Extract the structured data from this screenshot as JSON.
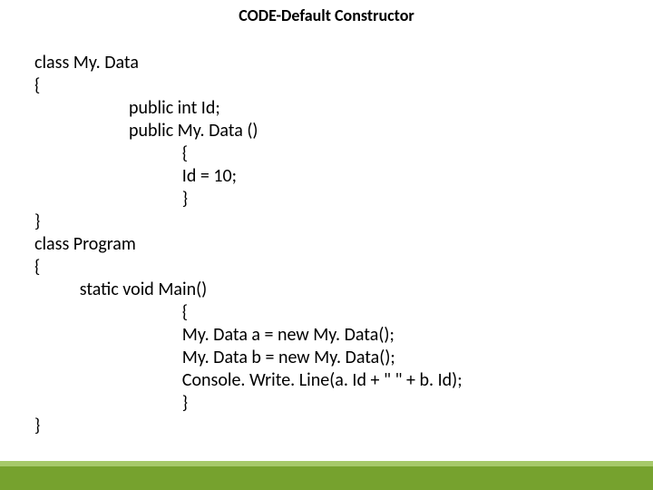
{
  "title": "CODE-Default Constructor",
  "code": {
    "l1": "class My. Data",
    "l2": "{",
    "l3": "                       public int Id;",
    "l4": "                       public My. Data ()",
    "l5": "                                    {",
    "l6": "                                    Id = 10;",
    "l7": "                                    }",
    "l8": "}",
    "l9": "class Program",
    "l10": "{",
    "l11": "           static void Main()",
    "l12": "                                    {",
    "l13": "                                    My. Data a = new My. Data();",
    "l14": "                                    My. Data b = new My. Data();",
    "l15": "                                    Console. Write. Line(a. Id + \" \" + b. Id);",
    "l16": "                                    }",
    "l17": "}"
  }
}
